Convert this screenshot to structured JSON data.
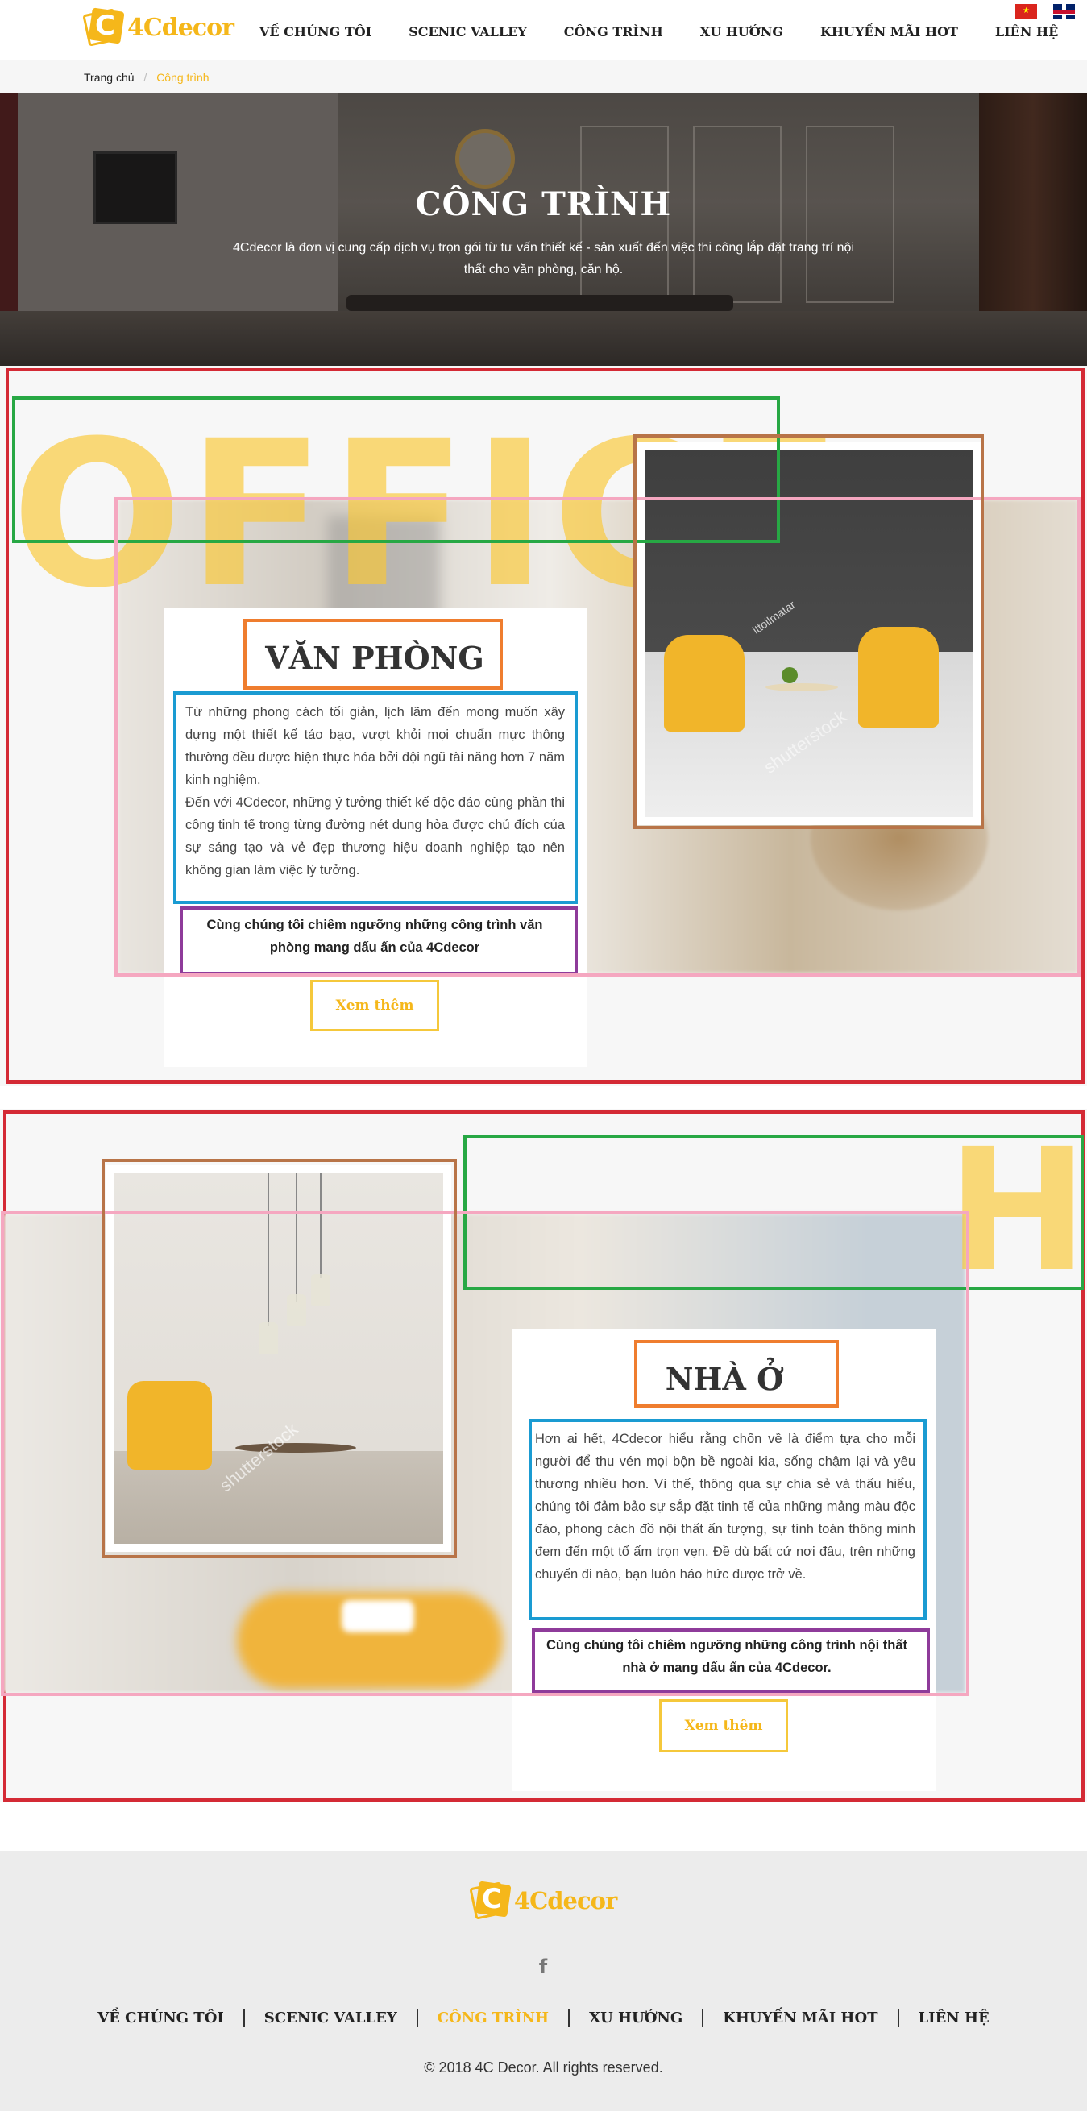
{
  "header": {
    "logo_text": "4Cdecor",
    "logo_letter": "C",
    "nav": [
      "VỀ CHÚNG TÔI",
      "SCENIC VALLEY",
      "CÔNG TRÌNH",
      "XU HƯỚNG",
      "KHUYẾN MÃI HOT",
      "LIÊN HỆ"
    ],
    "active_nav": "CÔNG TRÌNH",
    "languages": [
      "vi-flag",
      "en-flag"
    ]
  },
  "breadcrumb": {
    "home": "Trang chủ",
    "separator": "/",
    "current": "Công trình"
  },
  "hero": {
    "title": "CÔNG TRÌNH",
    "subtitle": "4Cdecor là đơn vị cung cấp dịch vụ trọn gói từ tư vấn thiết kế - sản xuất đến việc thi công lắp đặt trang trí nội thất cho văn phòng, căn hộ."
  },
  "office": {
    "big_word": "OFFICE",
    "title": "VĂN PHÒNG",
    "body_1": "Từ những phong cách tối giản, lịch lãm đến mong muốn xây dựng một thiết kế táo bạo, vượt khỏi mọi chuẩn mực thông thường đều được hiện thực hóa bởi đội ngũ tài năng hơn 7 năm kinh nghiệm.",
    "body_2": "Đến với 4Cdecor, những ý tưởng thiết kế độc đáo cùng phần thi công tinh tế trong từng đường nét dung hòa được chủ đích của sự sáng tạo và vẻ đẹp thương hiệu doanh nghiệp tạo nên không gian làm việc lý tưởng.",
    "quote": "Cùng chúng tôi chiêm ngưỡng những công trình văn phòng mang dấu ấn của 4Cdecor",
    "button": "Xem thêm",
    "watermark_1": "shutterstock",
    "watermark_2": "ittoilmatar"
  },
  "home": {
    "big_word": "H",
    "title": "NHÀ Ở",
    "body": "Hơn ai hết, 4Cdecor hiểu rằng chốn về là điểm tựa cho mỗi người để thu vén mọi bộn bề ngoài kia, sống chậm lại và yêu thương nhiều hơn. Vì thế, thông qua sự chia sẻ và thấu hiểu, chúng tôi đảm bảo sự sắp đặt tinh tế của những mảng màu độc đáo, phong cách đồ nội thất ấn tượng, sự tính toán thông minh đem đến một tổ ấm trọn vẹn. Đề dù bất cứ nơi đâu, trên những chuyến đi nào, bạn luôn háo hức được trở về.",
    "quote": "Cùng chúng tôi chiêm ngưỡng những công trình nội thất nhà ở mang dấu ấn của 4Cdecor.",
    "button": "Xem thêm",
    "watermark": "shutterstock"
  },
  "footer": {
    "logo_text": "4Cdecor",
    "logo_letter": "C",
    "social_icon": "f",
    "nav": [
      "VỀ CHÚNG TÔI",
      "SCENIC VALLEY",
      "CÔNG TRÌNH",
      "XU HƯỚNG",
      "KHUYẾN MÃI HOT",
      "LIÊN HỆ"
    ],
    "active_nav": "CÔNG TRÌNH",
    "copyright": "© 2018 4C Decor. All rights reserved."
  },
  "colors": {
    "accent": "#f5b71a",
    "annotation_red": "#d42a35",
    "annotation_green": "#27a844",
    "annotation_pink": "#f5a7c0",
    "annotation_brown": "#b87448",
    "annotation_orange": "#ef7d2e",
    "annotation_blue": "#1a9bd2",
    "annotation_purple": "#8e3b9a"
  }
}
